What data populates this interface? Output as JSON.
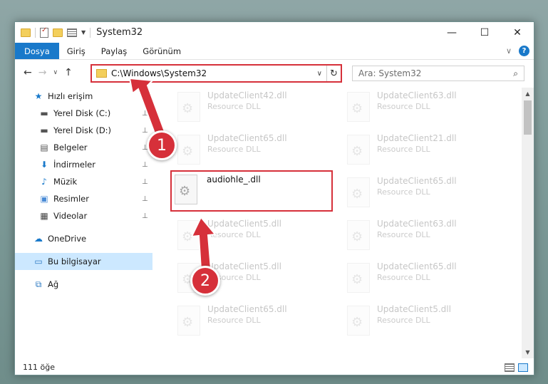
{
  "window": {
    "title": "System32",
    "minimize": "—",
    "maximize": "☐",
    "close": "✕"
  },
  "ribbon": {
    "tabs": [
      "Dosya",
      "Giriş",
      "Paylaş",
      "Görünüm"
    ],
    "expand": "∨",
    "help": "?"
  },
  "address": {
    "path": "C:\\Windows\\System32",
    "dropdown": "∨",
    "refresh": "↻"
  },
  "search": {
    "placeholder": "Ara: System32",
    "icon": "search-icon"
  },
  "nav": {
    "back": "←",
    "forward": "→",
    "recent": "∨",
    "up": "↑"
  },
  "sidebar": {
    "items": [
      {
        "label": "Hızlı erişim",
        "icon": "star-icon",
        "glyph": "★",
        "pinned": false
      },
      {
        "label": "Yerel Disk (C:)",
        "icon": "drive-icon",
        "glyph": "▬",
        "pinned": true
      },
      {
        "label": "Yerel Disk (D:)",
        "icon": "drive-icon",
        "glyph": "▬",
        "pinned": true
      },
      {
        "label": "Belgeler",
        "icon": "documents-icon",
        "glyph": "▤",
        "pinned": true
      },
      {
        "label": "İndirmeler",
        "icon": "download-icon",
        "glyph": "⬇",
        "pinned": true
      },
      {
        "label": "Müzik",
        "icon": "music-icon",
        "glyph": "♪",
        "pinned": true
      },
      {
        "label": "Resimler",
        "icon": "pictures-icon",
        "glyph": "▣",
        "pinned": true
      },
      {
        "label": "Videolar",
        "icon": "video-icon",
        "glyph": "▦",
        "pinned": true
      },
      {
        "label": "OneDrive",
        "icon": "cloud-icon",
        "glyph": "☁",
        "pinned": false
      },
      {
        "label": "Bu bilgisayar",
        "icon": "computer-icon",
        "glyph": "▭",
        "pinned": false
      },
      {
        "label": "Ağ",
        "icon": "network-icon",
        "glyph": "⧉",
        "pinned": false
      }
    ],
    "pin_glyph": "📌"
  },
  "files": [
    {
      "name": "UpdateClient42.dll",
      "desc": "Resource DLL"
    },
    {
      "name": "UpdateClient63.dll",
      "desc": "Resource DLL"
    },
    {
      "name": "UpdateClient65.dll",
      "desc": "Resource DLL"
    },
    {
      "name": "UpdateClient21.dll",
      "desc": "Resource DLL"
    },
    {
      "name": "audiohle_.dll",
      "desc": ""
    },
    {
      "name": "UpdateClient65.dll",
      "desc": "Resource DLL"
    },
    {
      "name": "UpdateClient5.dll",
      "desc": "Resource DLL"
    },
    {
      "name": "UpdateClient63.dll",
      "desc": "Resource DLL"
    },
    {
      "name": "UpdateClient5.dll",
      "desc": "Resource DLL"
    },
    {
      "name": "UpdateClient65.dll",
      "desc": "Resource DLL"
    },
    {
      "name": "UpdateClient65.dll",
      "desc": "Resource DLL"
    },
    {
      "name": "UpdateClient5.dll",
      "desc": "Resource DLL"
    }
  ],
  "status": {
    "count": "111 öğe"
  },
  "annotations": {
    "step1": "1",
    "step2": "2",
    "color": "#d6303a"
  }
}
